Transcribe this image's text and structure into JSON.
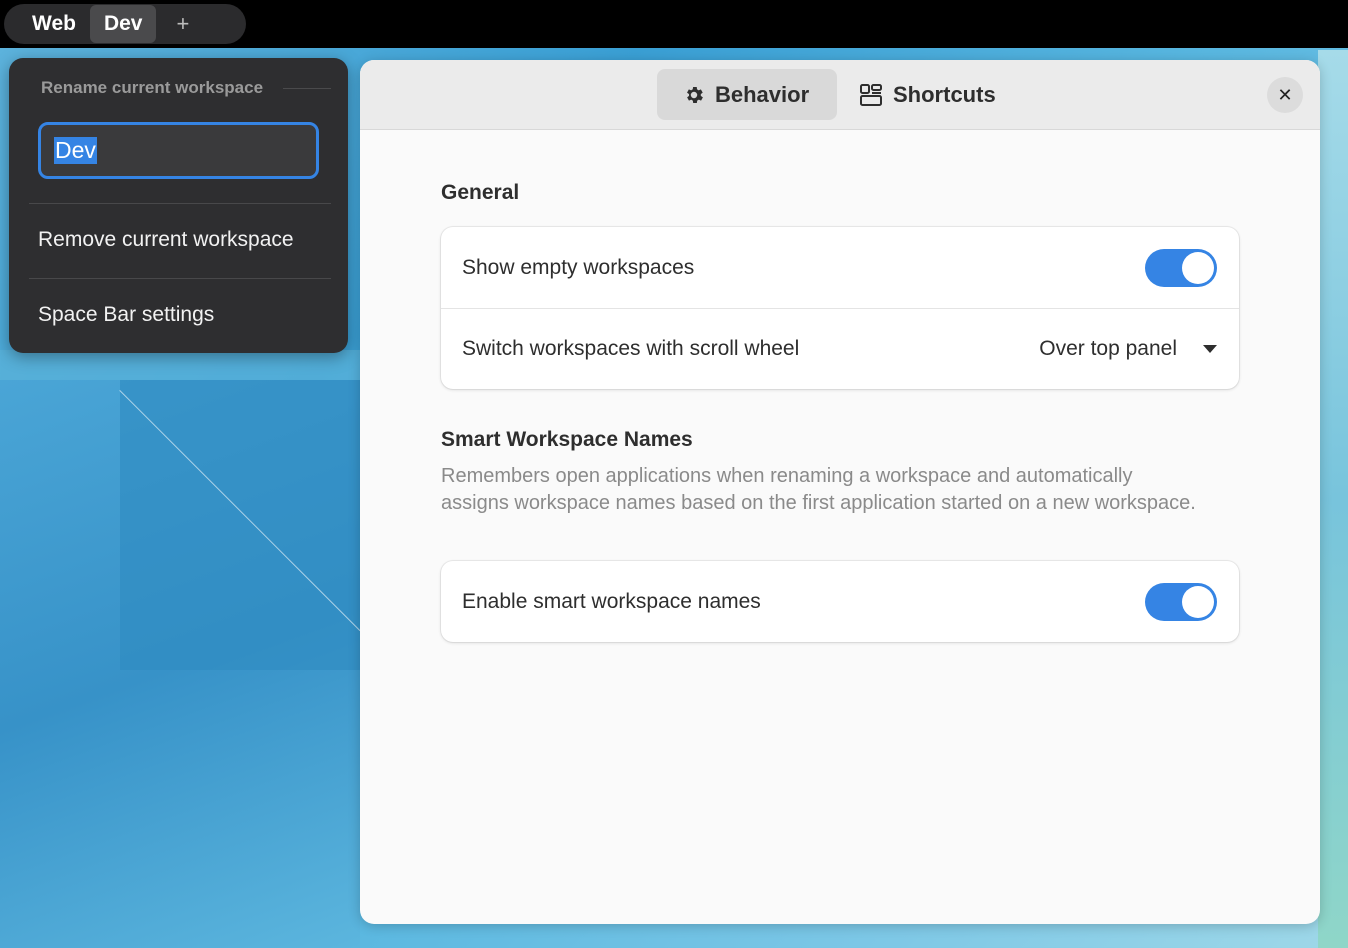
{
  "topbar": {
    "workspaces": [
      {
        "label": "Web",
        "active": false
      },
      {
        "label": "Dev",
        "active": true
      }
    ],
    "add_label": "+"
  },
  "popup": {
    "header": "Rename current workspace",
    "rename_value": "Dev",
    "items": [
      {
        "label": "Remove current workspace"
      },
      {
        "label": "Space Bar settings"
      }
    ]
  },
  "window": {
    "tabs": [
      {
        "label": "Behavior",
        "icon": "gear-icon",
        "active": true
      },
      {
        "label": "Shortcuts",
        "icon": "shortcuts-icon",
        "active": false
      }
    ],
    "close_label": "✕",
    "sections": {
      "general": {
        "title": "General",
        "rows": [
          {
            "label": "Show empty workspaces",
            "type": "switch",
            "on": true
          },
          {
            "label": "Switch workspaces with scroll wheel",
            "type": "dropdown",
            "value": "Over top panel"
          }
        ]
      },
      "smart": {
        "title": "Smart Workspace Names",
        "description": "Remembers open applications when renaming a workspace and automatically assigns workspace names based on the first application started on a new workspace.",
        "rows": [
          {
            "label": "Enable smart workspace names",
            "type": "switch",
            "on": true
          }
        ]
      }
    }
  },
  "colors": {
    "accent": "#3584e4",
    "popup_bg": "#2e2e30",
    "window_bg": "#fafafa"
  }
}
